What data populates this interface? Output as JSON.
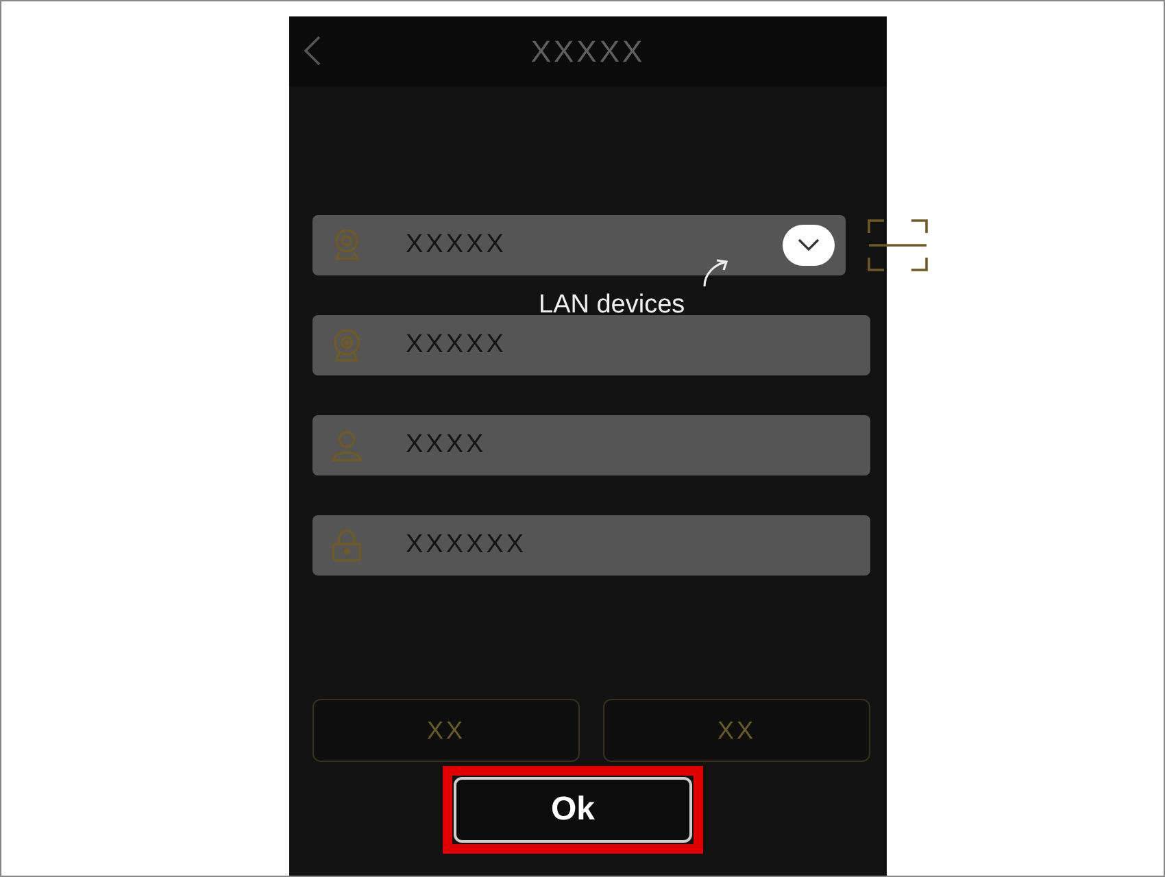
{
  "header": {
    "title": "XXXXX"
  },
  "fields": [
    {
      "kind": "device",
      "placeholder": "XXXXX"
    },
    {
      "kind": "camera",
      "placeholder": "XXXXX"
    },
    {
      "kind": "user",
      "placeholder": "XXXX"
    },
    {
      "kind": "lock",
      "placeholder": "XXXXXX"
    }
  ],
  "callout": {
    "text": "LAN devices"
  },
  "buttons": [
    {
      "label": "XX"
    },
    {
      "label": "XX"
    }
  ],
  "ok_button": {
    "label": "Ok"
  }
}
